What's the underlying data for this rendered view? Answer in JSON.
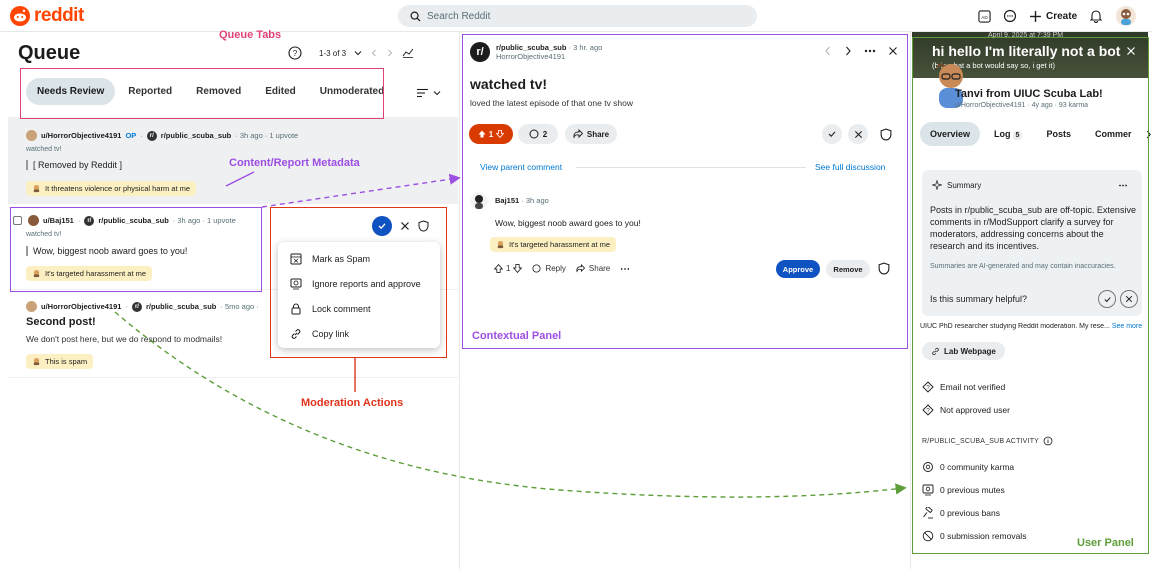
{
  "app": {
    "logo_text": "reddit"
  },
  "search": {
    "placeholder": "Search Reddit"
  },
  "topbar": {
    "create_label": "Create"
  },
  "queue": {
    "title": "Queue",
    "pager": "1-3 of 3",
    "tabs": [
      "Needs Review",
      "Reported",
      "Removed",
      "Edited",
      "Unmoderated"
    ],
    "active_tab": "Needs Review"
  },
  "items": [
    {
      "user": "u/HorrorObjective4191",
      "op": "OP",
      "sub": "r/public_scuba_sub",
      "meta": "· 3h ago · 1 upvote",
      "post_title": "watched tv!",
      "body": "[ Removed by Reddit ]",
      "badge": "It threatens violence or physical harm at me"
    },
    {
      "user": "u/Baj151",
      "sub": "r/public_scuba_sub",
      "meta": "· 3h ago · 1 upvote",
      "post_title": "watched tv!",
      "body": "Wow, biggest noob award goes to you!",
      "badge": "It's targeted harassment at me"
    },
    {
      "user": "u/HorrorObjective4191",
      "sub": "r/public_scuba_sub",
      "meta": "· 5mo ago ·",
      "post_title": "Second post!",
      "body": "We don't post here, but we do respond to modmails!",
      "badge": "This is spam"
    }
  ],
  "mod_menu": {
    "items": [
      "Mark as Spam",
      "Ignore reports and approve",
      "Lock comment",
      "Copy link"
    ]
  },
  "context": {
    "sub": "r/public_scuba_sub",
    "time": "· 3 hr. ago",
    "author": "HorrorObjective4191",
    "title": "watched tv!",
    "body": "loved the latest episode of that one tv show",
    "votes": "1",
    "comments": "2",
    "share": "Share",
    "view_parent": "View parent comment",
    "see_full": "See full discussion",
    "comment_user": "Baj151",
    "comment_time": "· 3h ago",
    "comment_text": "Wow, biggest noob award goes to you!",
    "comment_badge": "It's targeted harassment at me",
    "comment_votes": "1",
    "reply": "Reply",
    "approve": "Approve",
    "remove": "Remove"
  },
  "user_panel": {
    "banner_date": "April 9, 2025 at 7:39 PM",
    "banner_text": "hi hello I'm literally not a bot",
    "banner_sub": "(b     is what a bot would say so, i get it)",
    "name": "Tanvi from UIUC Scuba Lab!",
    "sub": "u/HorrorObjective4191 · 4y ago · 93 karma",
    "tabs": [
      "Overview",
      "Log",
      "Posts",
      "Commer"
    ],
    "log_count": "5",
    "summary_label": "Summary",
    "summary_text": "Posts in r/public_scuba_sub are off-topic. Extensive comments in r/ModSupport clarify a survey for moderators, addressing concerns about the research and its incentives.",
    "summary_disclaimer": "Summaries are AI-generated and may contain inaccuracies.",
    "summary_question": "Is this summary helpful?",
    "bio": "UIUC PhD researcher studying Reddit moderation. My rese...",
    "see_more": "See more",
    "lab_button": "Lab Webpage",
    "email": "Email not verified",
    "approved": "Not approved user",
    "activity_heading": "R/PUBLIC_SCUBA_SUB ACTIVITY",
    "karma": "0 community karma",
    "mutes": "0 previous mutes",
    "bans": "0 previous bans",
    "removals": "0 submission removals"
  },
  "annotations": {
    "queue_tabs": "Queue Tabs",
    "metadata": "Content/Report Metadata",
    "contextual": "Contextual Panel",
    "moderation": "Moderation Actions",
    "user_panel": "User Panel"
  },
  "colors": {
    "brand": "#ff4500",
    "approve_blue": "#0f52c1",
    "pink": "#e0427a",
    "purple": "#9d4fe3",
    "red": "#e0341b",
    "green": "#5d9e3a"
  }
}
